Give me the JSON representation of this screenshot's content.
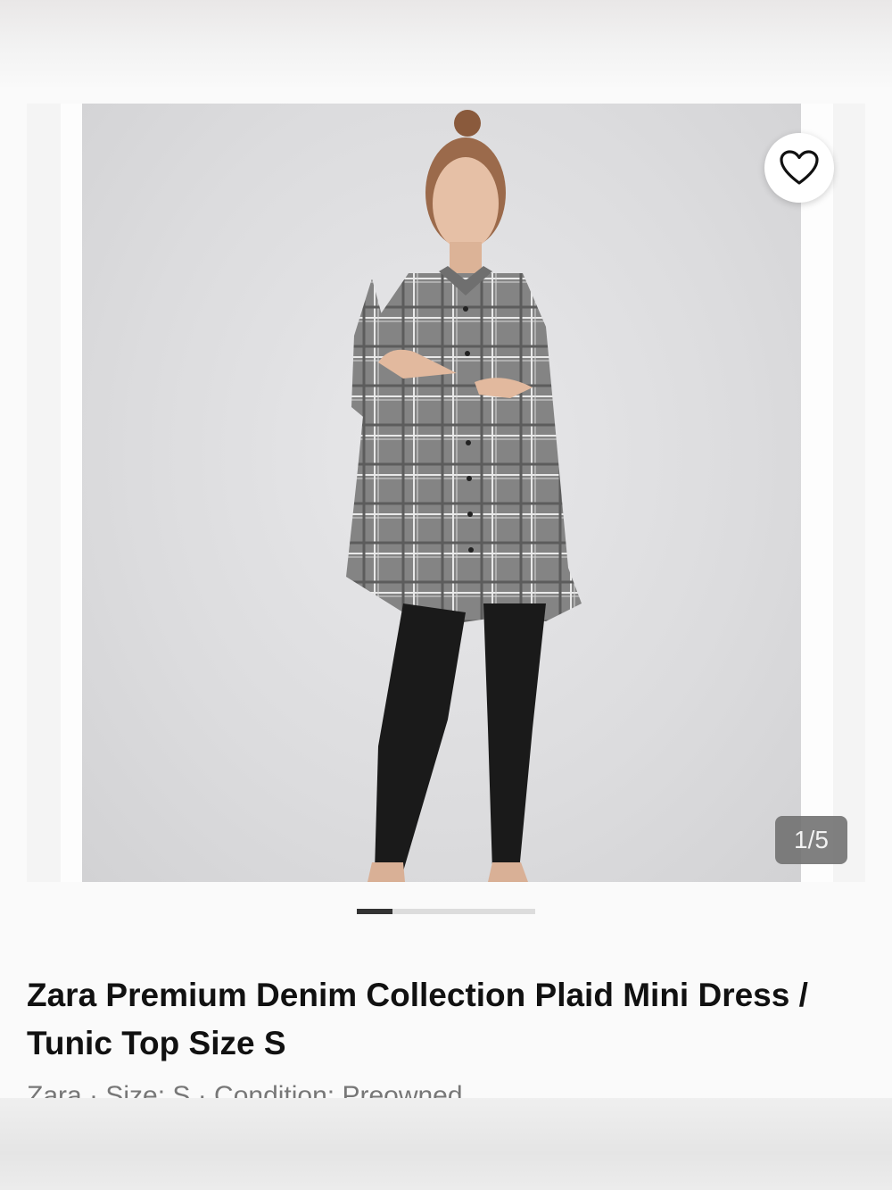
{
  "gallery": {
    "image_alt": "Model wearing grey plaid button-up tunic dress with black stirrup leggings",
    "counter": "1/5",
    "current_index": 1,
    "total_images": 5,
    "progress_fraction": 0.2
  },
  "listing": {
    "title": "Zara Premium Denim Collection Plaid Mini Dress / Tunic Top Size S",
    "meta": "Zara · Size: S · Condition: Preowned"
  },
  "icons": {
    "like": "heart-outline-icon"
  },
  "colors": {
    "counter_bg": "#6e6e6e",
    "progress_active": "#333333",
    "progress_track": "#dcdcdc",
    "title_text": "#111111"
  }
}
